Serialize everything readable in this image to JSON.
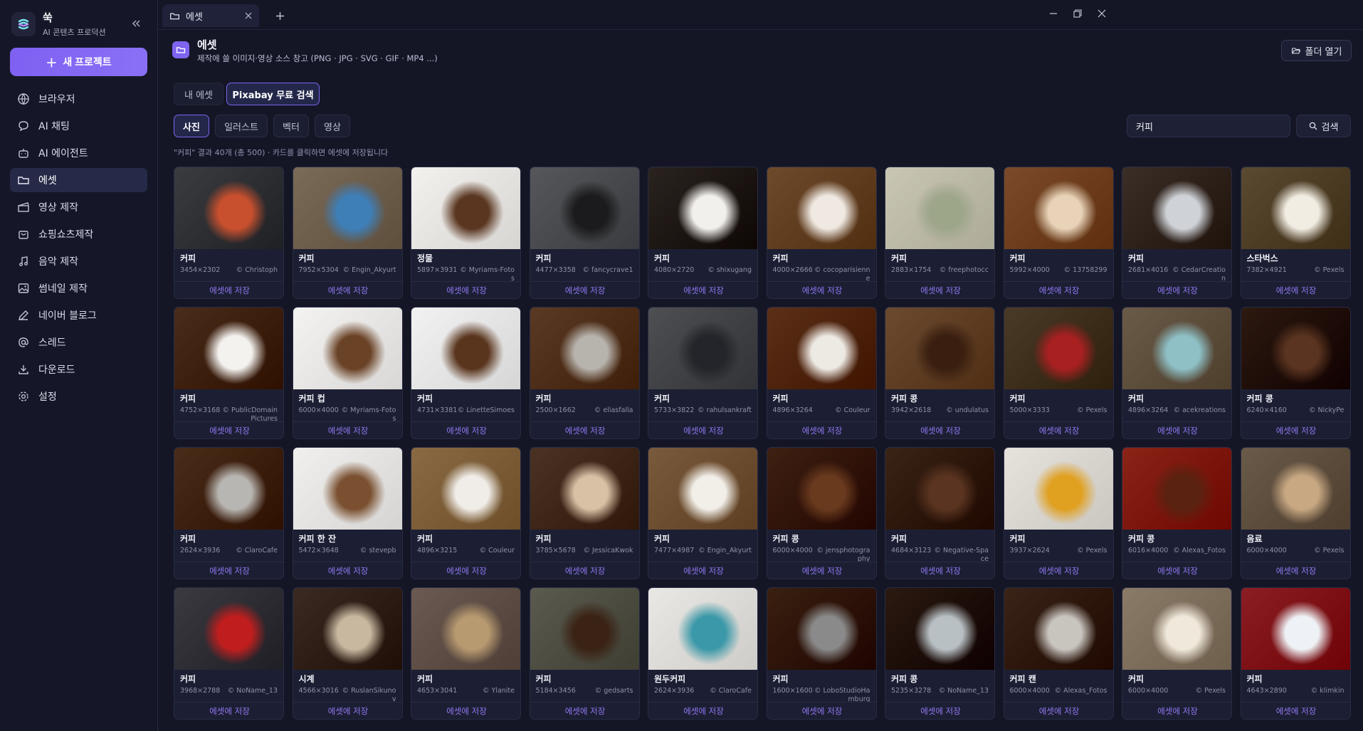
{
  "brand": {
    "name": "쑥",
    "subtitle": "AI 콘텐츠 프로덕션"
  },
  "sidebar": {
    "new_project": "새 프로젝트",
    "items": [
      {
        "label": "브라우저",
        "icon": "globe-icon"
      },
      {
        "label": "AI 채팅",
        "icon": "chat-icon"
      },
      {
        "label": "AI 에이전트",
        "icon": "robot-icon"
      },
      {
        "label": "에셋",
        "icon": "folder-icon",
        "active": true
      },
      {
        "label": "영상 제작",
        "icon": "clapper-icon"
      },
      {
        "label": "쇼핑쇼츠제작",
        "icon": "shopping-bag-icon"
      },
      {
        "label": "음악 제작",
        "icon": "music-icon"
      },
      {
        "label": "썸네일 제작",
        "icon": "image-icon"
      },
      {
        "label": "네이버 블로그",
        "icon": "pen-icon"
      },
      {
        "label": "스레드",
        "icon": "at-icon"
      },
      {
        "label": "다운로드",
        "icon": "download-icon"
      },
      {
        "label": "설정",
        "icon": "gear-icon"
      }
    ]
  },
  "tabs": [
    {
      "label": "에셋"
    }
  ],
  "header": {
    "title": "에셋",
    "subtitle": "제작에 쓸 이미지·영상 소스 창고 (PNG · JPG · SVG · GIF · MP4 ...)",
    "open_folder": "폴더 열기"
  },
  "source_tabs": {
    "mine": "내 에셋",
    "pixabay": "Pixabay 무료 검색"
  },
  "type_filters": [
    {
      "label": "사진",
      "active": true
    },
    {
      "label": "일러스트"
    },
    {
      "label": "벡터"
    },
    {
      "label": "영상"
    }
  ],
  "search": {
    "value": "커피",
    "button": "검색"
  },
  "result_info": "\"커피\" 결과 40개 (총 500) · 카드를 클릭하면 에셋에 저장됩니다",
  "save_label": "에셋에 저장",
  "cards": [
    {
      "title": "커피",
      "size": "3454×2302",
      "author": "© Christoph",
      "bg": "#3a3c40",
      "accent": "#c9502e"
    },
    {
      "title": "커피",
      "size": "7952×5304",
      "author": "© Engin_Akyurt",
      "bg": "#7a6a58",
      "accent": "#3e7fb8"
    },
    {
      "title": "정물",
      "size": "5897×3931",
      "author": "© Myriams-Fotos",
      "bg": "#f3f1ee",
      "accent": "#5a3620"
    },
    {
      "title": "커피",
      "size": "4477×3358",
      "author": "© fancycrave1",
      "bg": "#55575a",
      "accent": "#1b1b1d"
    },
    {
      "title": "커피",
      "size": "4080×2720",
      "author": "© shixugang",
      "bg": "#2a2320",
      "accent": "#f2f0ec"
    },
    {
      "title": "커피",
      "size": "4000×2666",
      "author": "© cocoparisienne",
      "bg": "#6e4a2c",
      "accent": "#efe9e2"
    },
    {
      "title": "커피",
      "size": "2883×1754",
      "author": "© freephotocc",
      "bg": "#c9c6b4",
      "accent": "#9ea68a"
    },
    {
      "title": "커피",
      "size": "5992×4000",
      "author": "© 13758299",
      "bg": "#7a4a2a",
      "accent": "#e8d3b8"
    },
    {
      "title": "커피",
      "size": "2681×4016",
      "author": "© CedarCreation",
      "bg": "#3b2e27",
      "accent": "#cfd3d8"
    },
    {
      "title": "스타벅스",
      "size": "7382×4921",
      "author": "© Pexels",
      "bg": "#5a4a32",
      "accent": "#f2ede3"
    },
    {
      "title": "커피",
      "size": "4752×3168",
      "author": "© PublicDomainPictures",
      "bg": "#4a2c1a",
      "accent": "#f4f2ef"
    },
    {
      "title": "커피 컵",
      "size": "6000×4000",
      "author": "© Myriams-Fotos",
      "bg": "#f4f3f1",
      "accent": "#6a4226"
    },
    {
      "title": "커피",
      "size": "4731×3381",
      "author": "© LinetteSimoes",
      "bg": "#f2f2f2",
      "accent": "#5a351d"
    },
    {
      "title": "커피",
      "size": "2500×1662",
      "author": "© eliasfalla",
      "bg": "#5a3a24",
      "accent": "#b7b3ad"
    },
    {
      "title": "커피",
      "size": "5733×3822",
      "author": "© rahulsankraft",
      "bg": "#4e4f52",
      "accent": "#23252a"
    },
    {
      "title": "커피",
      "size": "4896×3264",
      "author": "© Couleur",
      "bg": "#5b3018",
      "accent": "#ede9e3"
    },
    {
      "title": "커피 콩",
      "size": "3942×2618",
      "author": "© undulatus",
      "bg": "#6b4a30",
      "accent": "#3a1f10"
    },
    {
      "title": "커피",
      "size": "5000×3333",
      "author": "© Pexels",
      "bg": "#4a3a28",
      "accent": "#a82020"
    },
    {
      "title": "커피",
      "size": "4896×3264",
      "author": "© acekreations",
      "bg": "#6a5a48",
      "accent": "#8ec0c6"
    },
    {
      "title": "커피 콩",
      "size": "6240×4160",
      "author": "© NickyPe",
      "bg": "#2c1a10",
      "accent": "#5a3420"
    },
    {
      "title": "커피",
      "size": "2624×3936",
      "author": "© ClaroCafe",
      "bg": "#4a2c1a",
      "accent": "#b8b6b2"
    },
    {
      "title": "커피 한 잔",
      "size": "5472×3648",
      "author": "© stevepb",
      "bg": "#f1f0ee",
      "accent": "#7a5030"
    },
    {
      "title": "커피",
      "size": "4896×3215",
      "author": "© Couleur",
      "bg": "#8a6a44",
      "accent": "#f0ede8"
    },
    {
      "title": "커피",
      "size": "3785×5678",
      "author": "© JessicaKwok",
      "bg": "#4a3224",
      "accent": "#d8c2a6"
    },
    {
      "title": "커피",
      "size": "7477×4987",
      "author": "© Engin_Akyurt",
      "bg": "#7a5a3c",
      "accent": "#f2efe9"
    },
    {
      "title": "커피 콩",
      "size": "6000×4000",
      "author": "© jensphotography",
      "bg": "#3e2112",
      "accent": "#6a3a1e"
    },
    {
      "title": "커피",
      "size": "4684×3123",
      "author": "© Negative-Space",
      "bg": "#3a2416",
      "accent": "#5a3420"
    },
    {
      "title": "커피",
      "size": "3937×2624",
      "author": "© Pexels",
      "bg": "#e6e2dc",
      "accent": "#e0a020"
    },
    {
      "title": "커피 콩",
      "size": "6016×4000",
      "author": "© Alexas_Fotos",
      "bg": "#8a2418",
      "accent": "#5a2210"
    },
    {
      "title": "음료",
      "size": "6000×4000",
      "author": "© Pexels",
      "bg": "#6a5a4a",
      "accent": "#c8a882"
    },
    {
      "title": "커피",
      "size": "3968×2788",
      "author": "© NoName_13",
      "bg": "#3a3a40",
      "accent": "#c01e1e"
    },
    {
      "title": "시계",
      "size": "4566×3016",
      "author": "© RuslanSikunov",
      "bg": "#3a2a22",
      "accent": "#c8b8a0"
    },
    {
      "title": "커피",
      "size": "4653×3041",
      "author": "© Ylanite",
      "bg": "#6a5a52",
      "accent": "#b89a70"
    },
    {
      "title": "커피",
      "size": "5184×3456",
      "author": "© gedsarts",
      "bg": "#5a5a4e",
      "accent": "#3a2214"
    },
    {
      "title": "원두커피",
      "size": "2624×3936",
      "author": "© ClaroCafe",
      "bg": "#eae8e4",
      "accent": "#3a98a8"
    },
    {
      "title": "커피",
      "size": "1600×1600",
      "author": "© LoboStudioHamburg",
      "bg": "#3a2010",
      "accent": "#8a8a8a"
    },
    {
      "title": "커피 콩",
      "size": "5235×3278",
      "author": "© NoName_13",
      "bg": "#2a1a10",
      "accent": "#b8c0c4"
    },
    {
      "title": "커피 캔",
      "size": "6000×4000",
      "author": "© Alexas_Fotos",
      "bg": "#3a2418",
      "accent": "#c8c4be"
    },
    {
      "title": "커피",
      "size": "6000×4000",
      "author": "© Pexels",
      "bg": "#8a7a68",
      "accent": "#f0e8da"
    },
    {
      "title": "커피",
      "size": "4643×2890",
      "author": "© klimkin",
      "bg": "#8a1e22",
      "accent": "#eef2f6"
    }
  ]
}
